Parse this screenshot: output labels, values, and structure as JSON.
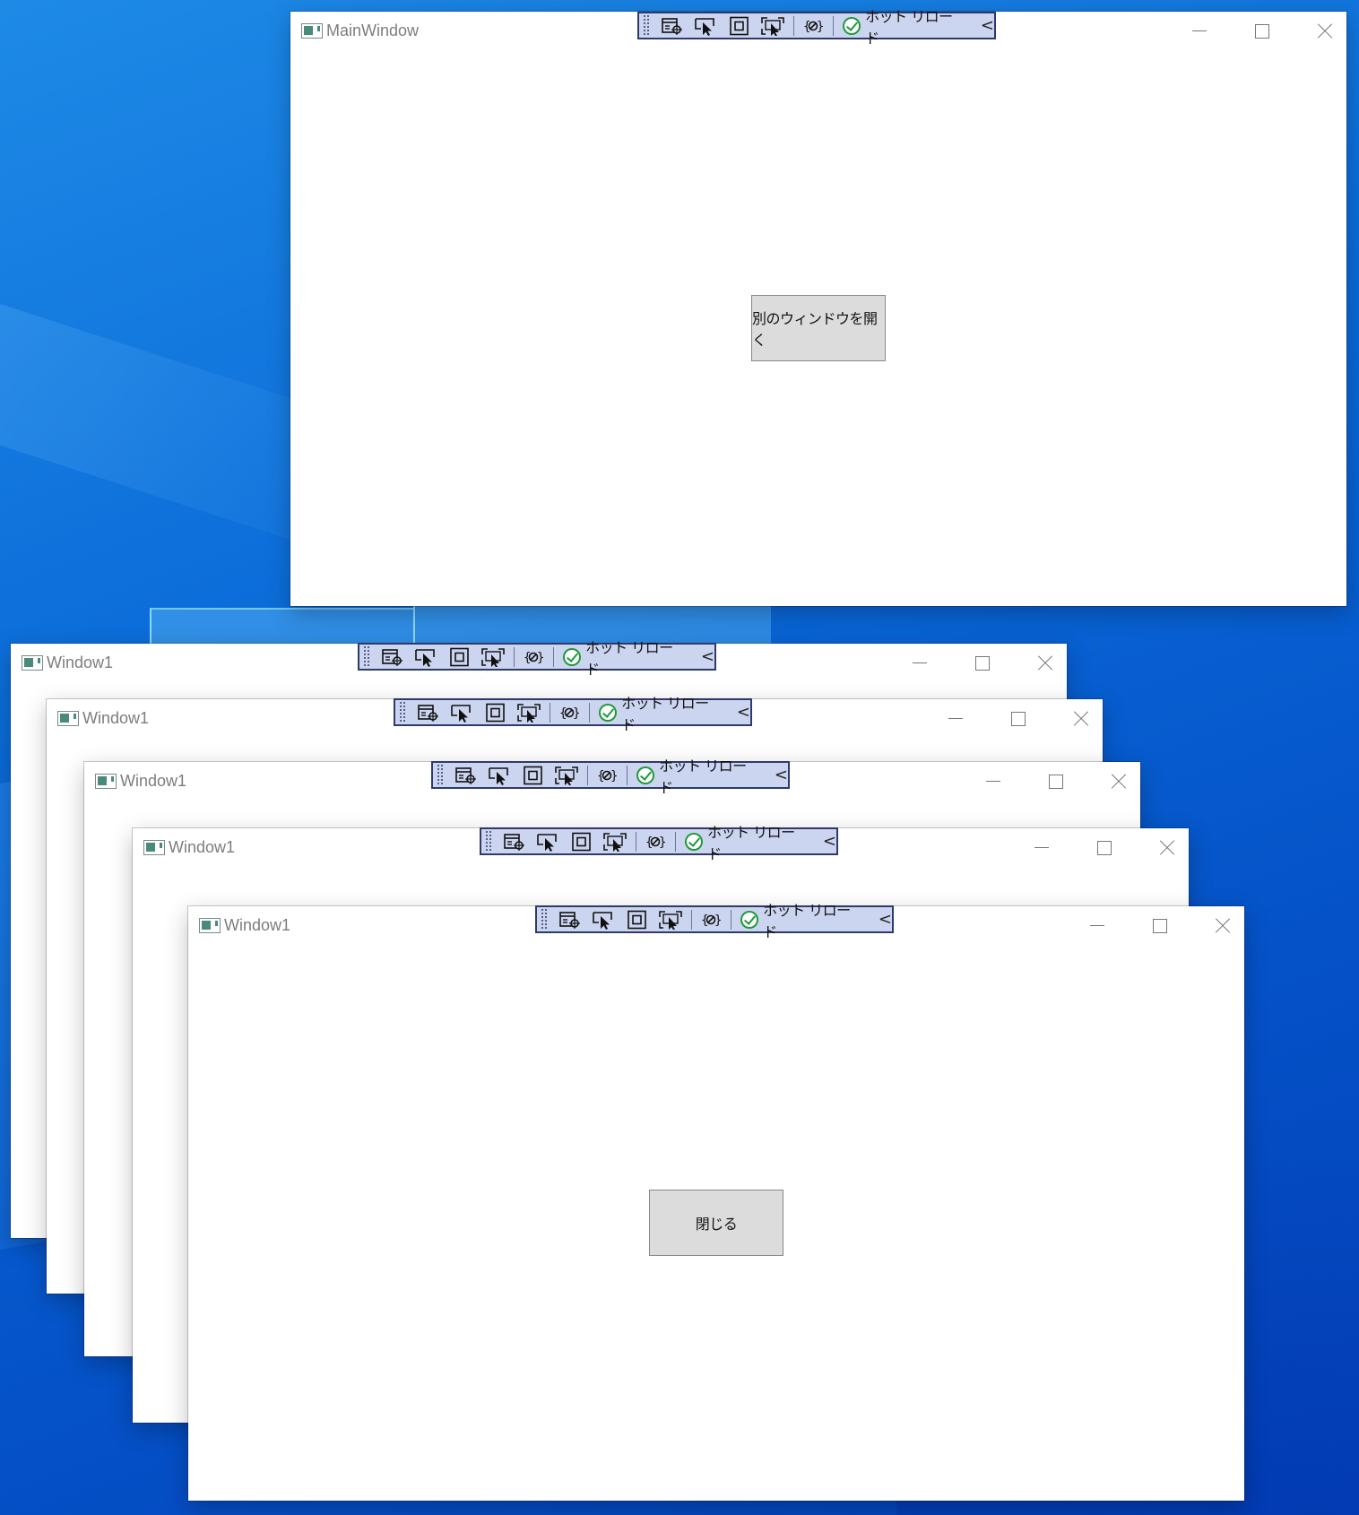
{
  "main_window": {
    "title": "MainWindow",
    "open_button_label": "別のウィンドウを開く"
  },
  "child_windows": [
    {
      "title": "Window1"
    },
    {
      "title": "Window1"
    },
    {
      "title": "Window1"
    },
    {
      "title": "Window1"
    },
    {
      "title": "Window1",
      "close_button_label": "閉じる"
    }
  ],
  "debug_toolbar": {
    "tools": [
      "live-visual-tree-icon",
      "select-element-icon",
      "display-layout-adorners-icon",
      "track-focus-icon",
      "binding-failures-icon"
    ],
    "hot_reload_label": "ホット リロード",
    "hot_reload_status": "ok",
    "collapse_glyph": "<"
  },
  "colors": {
    "toolbar_bg": "#ccd5f0",
    "toolbar_border": "#2e3a6a",
    "hot_reload_ok": "#1e9a3a",
    "button_bg": "#dcdcdc"
  }
}
